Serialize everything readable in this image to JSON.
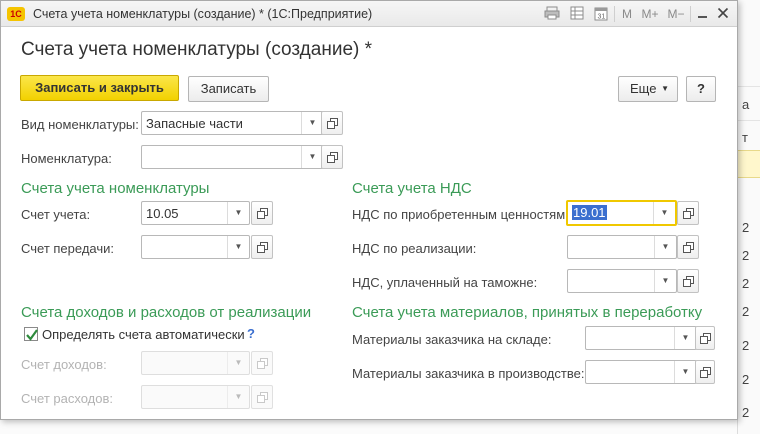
{
  "window": {
    "title": "Счета учета номенклатуры (создание) * (1С:Предприятие)",
    "app_icon_text": "1C",
    "titlebar_buttons": [
      "M",
      "M+",
      "M−"
    ]
  },
  "form": {
    "title": "Счета учета номенклатуры (создание) *",
    "buttons": {
      "save_close": "Записать и закрыть",
      "save": "Записать",
      "more": "Еще",
      "help": "?"
    },
    "fields": {
      "kind": {
        "label": "Вид номенклатуры:",
        "value": "Запасные части"
      },
      "item": {
        "label": "Номенклатура:",
        "value": ""
      }
    },
    "sections": {
      "item_accounts": "Счета учета номенклатуры",
      "vat_accounts": "Счета учета НДС",
      "income_expense": "Счета доходов и расходов от реализации",
      "materials": "Счета учета материалов, принятых в переработку"
    },
    "item_accounts": {
      "account": {
        "label": "Счет учета:",
        "value": "10.05"
      },
      "transfer": {
        "label": "Счет передачи:",
        "value": ""
      }
    },
    "vat": {
      "purchased": {
        "label": "НДС по приобретенным ценностям:",
        "value": "19.01"
      },
      "sales": {
        "label": "НДС по реализации:",
        "value": ""
      },
      "customs": {
        "label": "НДС, уплаченный на таможне:",
        "value": ""
      }
    },
    "income": {
      "auto_checkbox": {
        "label": "Определять счета автоматически",
        "checked": true,
        "help": "?"
      },
      "income_account": {
        "label": "Счет доходов:",
        "value": ""
      },
      "expense_account": {
        "label": "Счет расходов:",
        "value": ""
      }
    },
    "materials": {
      "warehouse": {
        "label": "Материалы заказчика на складе:",
        "value": ""
      },
      "production": {
        "label": "Материалы заказчика в производстве:",
        "value": ""
      }
    }
  },
  "background": {
    "right_column": [
      "а",
      "т",
      "2",
      "2",
      "2",
      "2",
      "2",
      "2",
      "2"
    ]
  },
  "colors": {
    "section_green": "#3b9b57",
    "primary_yellow": "#f2d100",
    "focus_border": "#f0c800",
    "selection_blue": "#3b6fcf"
  }
}
